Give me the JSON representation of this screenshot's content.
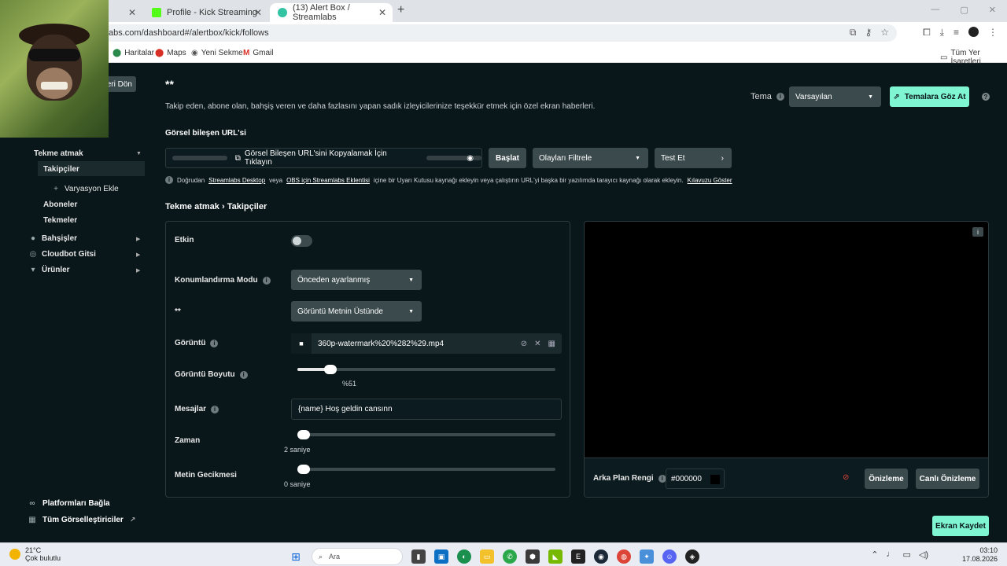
{
  "browser": {
    "tabs": [
      {
        "label": ""
      },
      {
        "label": "Profile - Kick Streaming"
      },
      {
        "label": "(13) Alert Box / Streamlabs"
      }
    ],
    "url": "abs.com/dashboard#/alertbox/kick/follows",
    "bookmarks": [
      {
        "label": "Haritalar"
      },
      {
        "label": "Maps"
      },
      {
        "label": "Yeni Sekme"
      },
      {
        "label": "Gmail"
      }
    ],
    "all_bookmarks": "Tüm Yer İşaretleri"
  },
  "sidebar": {
    "back_label": "eri Dön",
    "items": [
      {
        "label": "Tekme atmak"
      },
      {
        "label": "Takipçiler"
      },
      {
        "label": "Varyasyon Ekle"
      },
      {
        "label": "Aboneler"
      },
      {
        "label": "Tekmeler"
      },
      {
        "label": "Bahşişler"
      },
      {
        "label": "Cloudbot Gitsi"
      },
      {
        "label": "Ürünler"
      }
    ],
    "bottom": [
      {
        "label": "Platformları Bağla"
      },
      {
        "label": "Tüm Görselleştiriciler"
      }
    ]
  },
  "header": {
    "title": "**",
    "description": "Takip eden, abone olan, bahşiş veren ve daha fazlasını yapan sadık izleyicilerinize teşekkür etmek için özel ekran haberleri.",
    "theme_label": "Tema",
    "theme_value": "Varsayılan",
    "browse_themes": "Temalara Göz At",
    "help": "?"
  },
  "widget_url": {
    "label": "Görsel bileşen URL'si",
    "copy_text": "Görsel Bileşen URL'sini Kopyalamak İçin Tıklayın",
    "start": "Başlat",
    "filter": "Olayları Filtrele",
    "test": "Test Et",
    "note_pre": "Doğrudan",
    "note_link1": "Streamlabs Desktop",
    "note_mid1": "veya",
    "note_link2": "OBS için Streamlabs Eklentisi",
    "note_mid2": "içine bir Uyarı Kutusu kaynağı ekleyin veya çalıştırın URL'yi başka bir yazılımda tarayıcı kaynağı olarak ekleyin.",
    "note_link3": "Kılavuzu Göster"
  },
  "breadcrumb": {
    "part1": "Tekme atmak",
    "sep": "›",
    "part2": "Takipçiler"
  },
  "form": {
    "enabled_label": "Etkin",
    "enabled": false,
    "position_label": "Konumlandırma Modu",
    "position_value": "Önceden ayarlanmış",
    "layout_label": "**",
    "layout_value": "Görüntü Metnin Üstünde",
    "image_label": "Görüntü",
    "image_file": "360p-watermark%20%282%29.mp4",
    "image_size_label": "Görüntü Boyutu",
    "image_size": 51,
    "image_size_text": "%51",
    "messages_label": "Mesajlar",
    "message_value": "{name} Hoş geldin cansınn",
    "time_label": "Zaman",
    "time_text": "2 saniye",
    "time_level": 0,
    "text_delay_label": "Metin Gecikmesi",
    "text_delay_text": "0 saniye",
    "text_delay_level": 0
  },
  "preview": {
    "bg_label": "Arka Plan Rengi",
    "bg_color": "#000000",
    "preview_btn": "Önizleme",
    "live_preview_btn": "Canlı Önizleme"
  },
  "save_label": "Ekran Kaydet",
  "taskbar": {
    "temp": "21°C",
    "weather": "Çok bulutlu",
    "search": "Ara",
    "time": "03:10",
    "date": "17.08.2026"
  },
  "colors": {
    "accent": "#80f5d2",
    "background": "#09161a",
    "control": "#3b4a4d"
  }
}
